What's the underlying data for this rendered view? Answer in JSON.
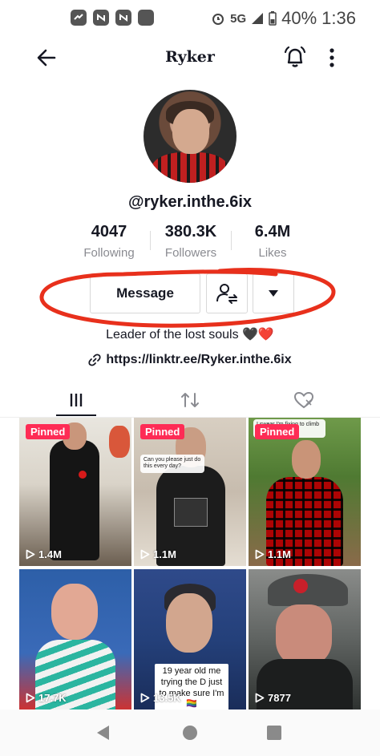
{
  "status_bar": {
    "network": "5G",
    "battery": "40%",
    "time": "1:36"
  },
  "header": {
    "title": "Ryker"
  },
  "profile": {
    "username": "@ryker.inthe.6ix",
    "stats": [
      {
        "value": "4047",
        "label": "Following"
      },
      {
        "value": "380.3K",
        "label": "Followers"
      },
      {
        "value": "6.4M",
        "label": "Likes"
      }
    ],
    "message_label": "Message",
    "bio": "Leader of the lost souls 🖤❤️",
    "link": "https://linktr.ee/Ryker.inthe.6ix"
  },
  "colors": {
    "accent": "#fe2c55",
    "annotation_red": "#e8301c"
  },
  "videos": [
    {
      "pinned": "Pinned",
      "views": "1.4M",
      "caption": ""
    },
    {
      "pinned": "Pinned",
      "views": "1.1M",
      "caption": "Can you please just do this every day?"
    },
    {
      "pinned": "Pinned",
      "views": "1.1M",
      "caption": "I swear I'm fixing to climb ... change"
    },
    {
      "pinned": "",
      "views": "17.7K",
      "caption": ""
    },
    {
      "pinned": "",
      "views": "13.5K",
      "caption": "19 year old me trying the D just to make sure I'm 🏳️‍🌈"
    },
    {
      "pinned": "",
      "views": "7877",
      "caption": ""
    }
  ]
}
